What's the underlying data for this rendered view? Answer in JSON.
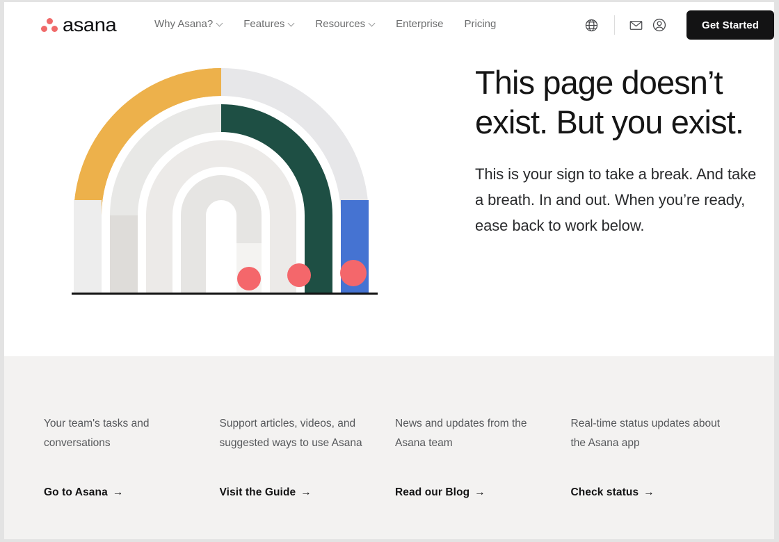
{
  "brand": {
    "name": "asana",
    "dot_color": "#f06a6a",
    "accent_black": "#131314"
  },
  "header": {
    "nav": [
      {
        "label": "Why Asana?",
        "has_dropdown": true,
        "name": "nav-why-asana"
      },
      {
        "label": "Features",
        "has_dropdown": true,
        "name": "nav-features"
      },
      {
        "label": "Resources",
        "has_dropdown": true,
        "name": "nav-resources"
      },
      {
        "label": "Enterprise",
        "has_dropdown": false,
        "name": "nav-enterprise"
      },
      {
        "label": "Pricing",
        "has_dropdown": false,
        "name": "nav-pricing"
      }
    ],
    "icons": [
      {
        "icon": "globe-icon",
        "label": "Language"
      },
      {
        "icon": "envelope-icon",
        "label": "Contact sales"
      },
      {
        "icon": "user-icon",
        "label": "Log in"
      }
    ],
    "cta_label": "Get Started"
  },
  "hero": {
    "title": "This page doesn’t exist. But you exist.",
    "title_line1": "This page doesn’t",
    "title_line2": "exist. But you exist.",
    "subtitle": "This is your sign to take a break. And take a breath. In and out. When you’re ready, ease back to work below.",
    "illustration": {
      "name": "concentric-arches-illustration",
      "description": "Four concentric arches with colored segments and three coral dots resting on a black ground line",
      "colors": {
        "yellow": "#edb14b",
        "light_gray": "#e6e6e8",
        "mid_gray": "#dddcd9",
        "pale_gray": "#ebeae8",
        "green": "#1e4f44",
        "blue": "#4573d2",
        "dot": "#f4676b",
        "ground": "#111111"
      },
      "dot_count": 3
    }
  },
  "footer": {
    "columns": [
      {
        "description": "Your team's tasks and conversations",
        "link": "Go to Asana",
        "arrow": "→",
        "name": "footer-card-go-to-asana"
      },
      {
        "description": "Support articles, videos, and suggested ways to use Asana",
        "link": "Visit the Guide",
        "arrow": "→",
        "name": "footer-card-visit-the-guide"
      },
      {
        "description": "News and updates from the Asana team",
        "link": "Read our Blog",
        "arrow": "→",
        "name": "footer-card-read-our-blog"
      },
      {
        "description": "Real-time status updates about the Asana app",
        "link": "Check status",
        "arrow": "→",
        "name": "footer-card-check-status"
      }
    ]
  }
}
